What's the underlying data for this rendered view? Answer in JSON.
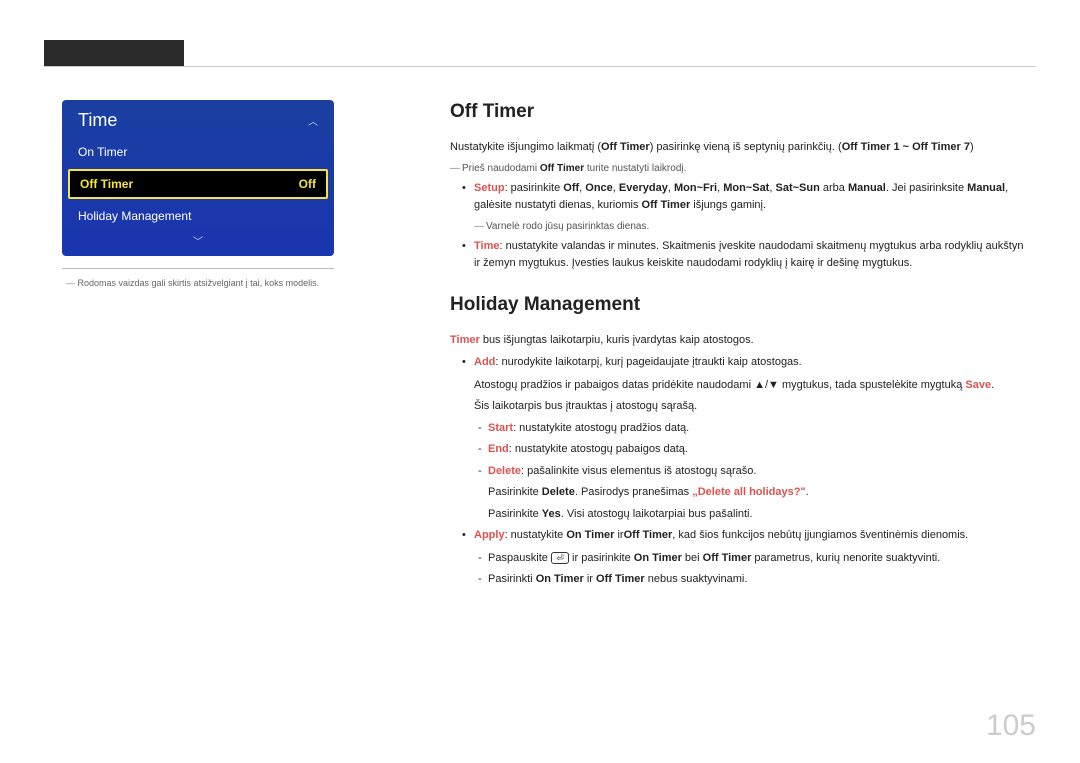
{
  "sidebar": {
    "title": "Time",
    "items": [
      {
        "label": "On Timer"
      },
      {
        "label": "Off Timer",
        "value": "Off"
      },
      {
        "label": "Holiday Management"
      }
    ],
    "note": "Rodomas vaizdas gali skirtis atsižvelgiant į tai, koks modelis."
  },
  "offTimer": {
    "heading": "Off Timer",
    "desc_pre": "Nustatykite išjungimo laikmatį (",
    "desc_b1": "Off Timer",
    "desc_mid": ") pasirinkę vieną iš septynių parinkčių. (",
    "desc_b2": "Off Timer 1 ~ Off Timer 7",
    "desc_post": ")",
    "note_pre": "Prieš naudodami ",
    "note_b": "Off Timer",
    "note_post": " turite nustatyti laikrodį.",
    "setup": {
      "label": "Setup",
      "pre": ": pasirinkite ",
      "opts": [
        "Off",
        "Once",
        "Everyday",
        "Mon~Fri",
        "Mon~Sat",
        "Sat~Sun"
      ],
      "arba": " arba ",
      "man1": "Manual",
      "mid": ". Jei pasirinksite ",
      "man2": "Manual",
      "post_pre": ", galėsite nustatyti dienas, kuriomis ",
      "ot": "Off Timer",
      "post": " išjungs gaminį."
    },
    "check_note": "Varnelė rodo jūsų pasirinktas dienas.",
    "time": {
      "label": "Time",
      "text": ": nustatykite valandas ir minutes. Skaitmenis įveskite naudodami skaitmenų mygtukus arba rodyklių aukštyn ir žemyn mygtukus. Įvesties laukus keiskite naudodami rodyklių į kairę ir dešinę mygtukus."
    }
  },
  "holiday": {
    "heading": "Holiday Management",
    "desc_b": "Timer",
    "desc": " bus išjungtas laikotarpiu, kuris įvardytas kaip atostogos.",
    "add": {
      "label": "Add",
      "text": ": nurodykite laikotarpį, kurį pageidaujate įtraukti kaip atostogas.",
      "sub_pre": "Atostogų pradžios ir pabaigos datas pridėkite naudodami ▲/▼ mygtukus, tada spustelėkite mygtuką ",
      "save": "Save",
      "sub_post": ".",
      "sub2": "Šis laikotarpis bus įtrauktas į atostogų sąrašą.",
      "start_l": "Start",
      "start_t": ": nustatykite atostogų pradžios datą.",
      "end_l": "End",
      "end_t": ": nustatykite atostogų pabaigos datą.",
      "del_l": "Delete",
      "del_t": ": pašalinkite visus elementus iš atostogų sąrašo.",
      "del2_pre": "Pasirinkite ",
      "del2_b": "Delete",
      "del2_mid": ". Pasirodys pranešimas ",
      "del2_q": "„Delete all holidays?\"",
      "del2_post": ".",
      "del3_pre": "Pasirinkite ",
      "del3_b": "Yes",
      "del3_post": ". Visi atostogų laikotarpiai bus pašalinti."
    },
    "apply": {
      "label": "Apply",
      "pre": ": nustatykite ",
      "on": "On Timer",
      "ir": " ir",
      "off": "Off Timer",
      "post": ", kad šios funkcijos nebūtų įjungiamos šventinėmis dienomis.",
      "s1_pre": "Paspauskite ",
      "s1_icon": "⏎",
      "s1_mid": " ir pasirinkite ",
      "s1_on": "On Timer",
      "s1_bei": " bei ",
      "s1_off": "Off Timer",
      "s1_post": " parametrus, kurių nenorite suaktyvinti.",
      "s2_pre": "Pasirinkti ",
      "s2_on": "On Timer",
      "s2_ir": " ir ",
      "s2_off": "Off Timer",
      "s2_post": " nebus suaktyvinami."
    }
  },
  "page": "105"
}
